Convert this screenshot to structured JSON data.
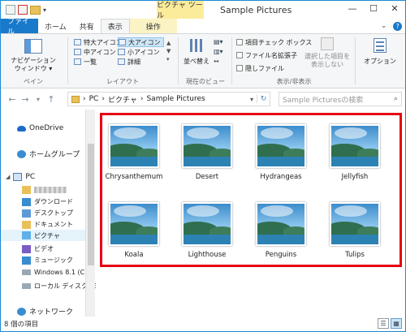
{
  "titlebar": {
    "contextual_label": "ピクチャ ツール",
    "title": "Sample Pictures",
    "minimize": "—",
    "maximize": "☐",
    "close": "✕"
  },
  "tabs": {
    "file": "ファイル",
    "home": "ホーム",
    "share": "共有",
    "view": "表示",
    "manage": "操作"
  },
  "ribbon": {
    "pane_group": {
      "nav_pane_line1": "ナビゲーション",
      "nav_pane_line2": "ウィンドウ ▾",
      "label": "ペイン"
    },
    "layout_group": {
      "extra_large": "特大アイコン",
      "large": "大アイコン",
      "medium": "中アイコン",
      "small": "小アイコン",
      "list": "一覧",
      "details": "詳細",
      "label": "レイアウト"
    },
    "current_view_group": {
      "sort_by": "並べ替え",
      "label": "現在のビュー"
    },
    "show_hide_group": {
      "item_check": "項目チェック ボックス",
      "file_ext": "ファイル名拡張子",
      "hidden": "隠しファイル",
      "hide_selected_line1": "選択した項目を",
      "hide_selected_line2": "表示しない",
      "label": "表示/非表示"
    },
    "options": "オプション"
  },
  "address": {
    "path_pc": "PC",
    "path_pictures": "ピクチャ",
    "path_sample": "Sample Pictures",
    "search_placeholder": "Sample Picturesの検索"
  },
  "nav_pane": {
    "onedrive": "OneDrive",
    "homegroup": "ホームグループ",
    "pc": "PC",
    "downloads": "ダウンロード",
    "desktop": "デスクトップ",
    "documents": "ドキュメント",
    "pictures": "ピクチャ",
    "videos": "ビデオ",
    "music": "ミュージック",
    "windows_drive": "Windows 8.1 (C",
    "local_disk": "ローカル ディスク (E",
    "network": "ネットワーク"
  },
  "files": [
    {
      "name": "Chrysanthemum"
    },
    {
      "name": "Desert"
    },
    {
      "name": "Hydrangeas"
    },
    {
      "name": "Jellyfish"
    },
    {
      "name": "Koala"
    },
    {
      "name": "Lighthouse"
    },
    {
      "name": "Penguins"
    },
    {
      "name": "Tulips"
    }
  ],
  "status": {
    "count": "8 個の項目"
  },
  "colors": {
    "accent": "#1979ca",
    "highlight": "#e60012",
    "contextual": "#fbec9b"
  }
}
